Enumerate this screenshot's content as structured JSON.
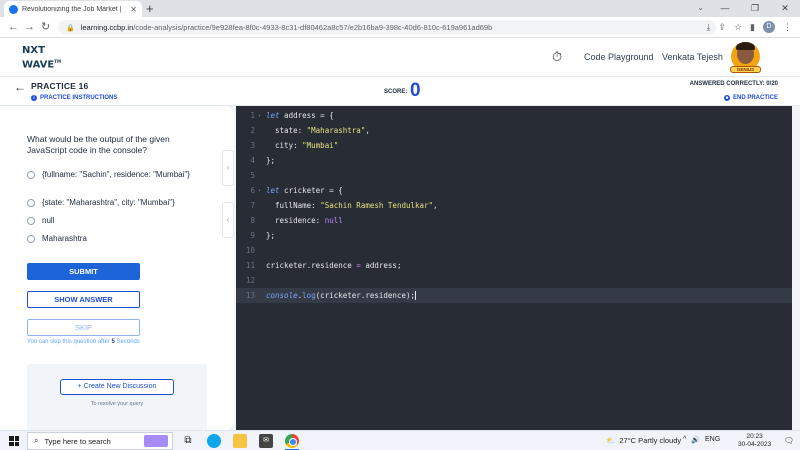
{
  "browser": {
    "tab_title": "Revolutionizing the Job Market |",
    "url_host": "learning.ccbp.in",
    "url_path": "/code-analysis/practice/9e928fea-8f0c-4933-8c31-df80462a8c57/e2b16ba9-398c-40d6-810c-619a961ad69b",
    "profile_initial": "D"
  },
  "header": {
    "logo_line1": "NXT",
    "logo_line2": "WAVE",
    "logo_tm": "TM",
    "code_playground": "Code Playground",
    "user_name": "Venkata Tejesh",
    "badge": "GENIUS"
  },
  "practice": {
    "title": "PRACTICE 16",
    "instructions": "PRACTICE INSTRUCTIONS",
    "score_label": "SCORE:",
    "score_value": "0",
    "answered": "ANSWERED CORRECTLY: 0/20",
    "end": "END PRACTICE"
  },
  "question": {
    "text": "What would be the output of the given JavaScript code in the console?",
    "options": [
      "{fullname: \"Sachin\", residence: \"Mumbai\"}",
      "{state: \"Maharashtra\", city: \"Mumbai\"}",
      "null",
      "Maharashtra"
    ],
    "submit": "SUBMIT",
    "show_answer": "SHOW ANSWER",
    "skip": "SKIP",
    "skip_note_prefix": "You can skip this question after",
    "skip_note_num": "5",
    "skip_note_suffix": "Seconds",
    "discussion_button": "+ Create New Discussion",
    "discussion_hint": "To resolve your query"
  },
  "editor": {
    "line_numbers": [
      "1",
      "2",
      "3",
      "4",
      "5",
      "6",
      "7",
      "8",
      "9",
      "10",
      "11",
      "12",
      "13"
    ]
  },
  "taskbar": {
    "search_placeholder": "Type here to search",
    "weather": "27°C  Partly cloudy",
    "lang": "ENG",
    "time": "20:23",
    "date": "30-04-2023"
  }
}
